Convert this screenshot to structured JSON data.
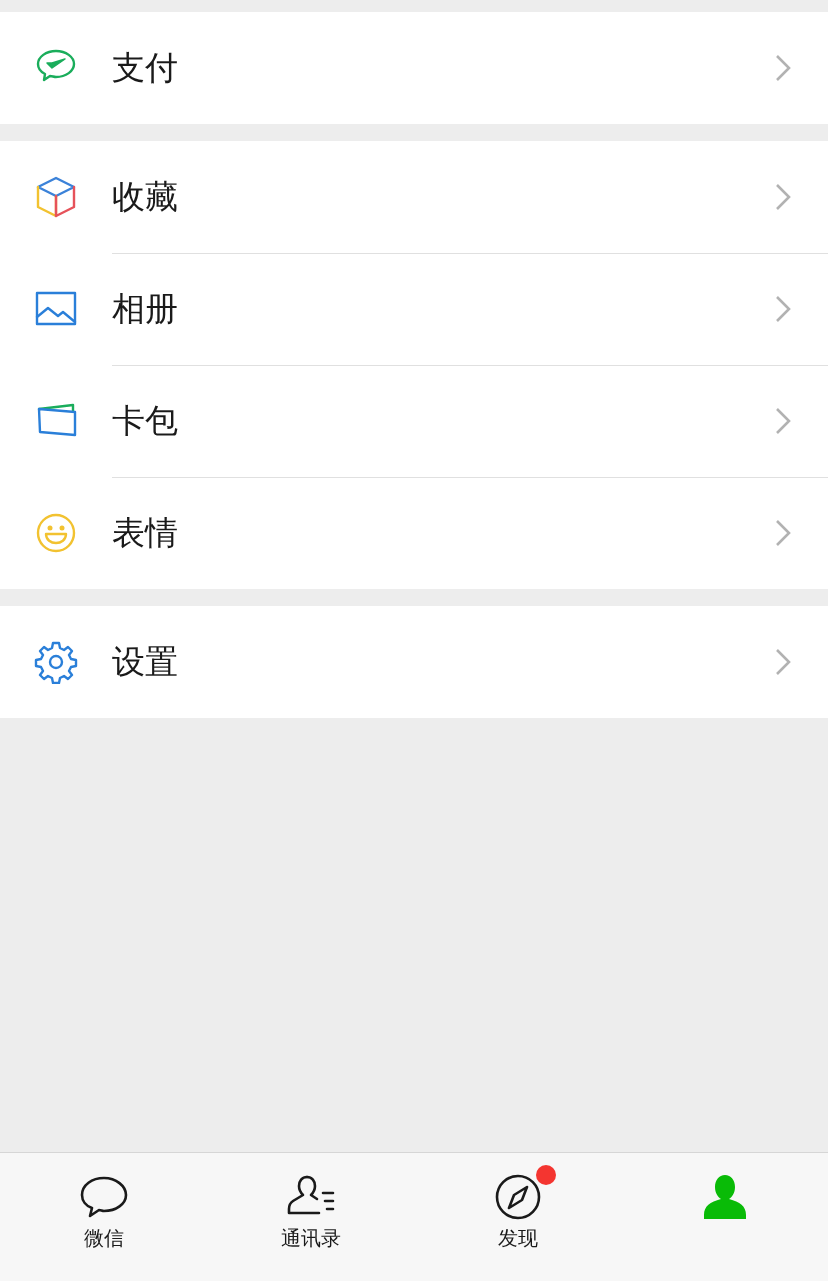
{
  "menu_groups": [
    {
      "items": [
        {
          "kind": "pay",
          "label": "支付"
        }
      ]
    },
    {
      "items": [
        {
          "kind": "favorites",
          "label": "收藏"
        },
        {
          "kind": "album",
          "label": "相册"
        },
        {
          "kind": "cards",
          "label": "卡包"
        },
        {
          "kind": "stickers",
          "label": "表情"
        }
      ]
    },
    {
      "items": [
        {
          "kind": "settings",
          "label": "设置"
        }
      ]
    }
  ],
  "tab_bar": [
    {
      "kind": "chats",
      "label": "微信",
      "selected": false,
      "badge": false
    },
    {
      "kind": "contacts",
      "label": "通讯录",
      "selected": false,
      "badge": false
    },
    {
      "kind": "discover",
      "label": "发现",
      "selected": false,
      "badge": true
    },
    {
      "kind": "me",
      "selected": true,
      "badge": false
    }
  ]
}
